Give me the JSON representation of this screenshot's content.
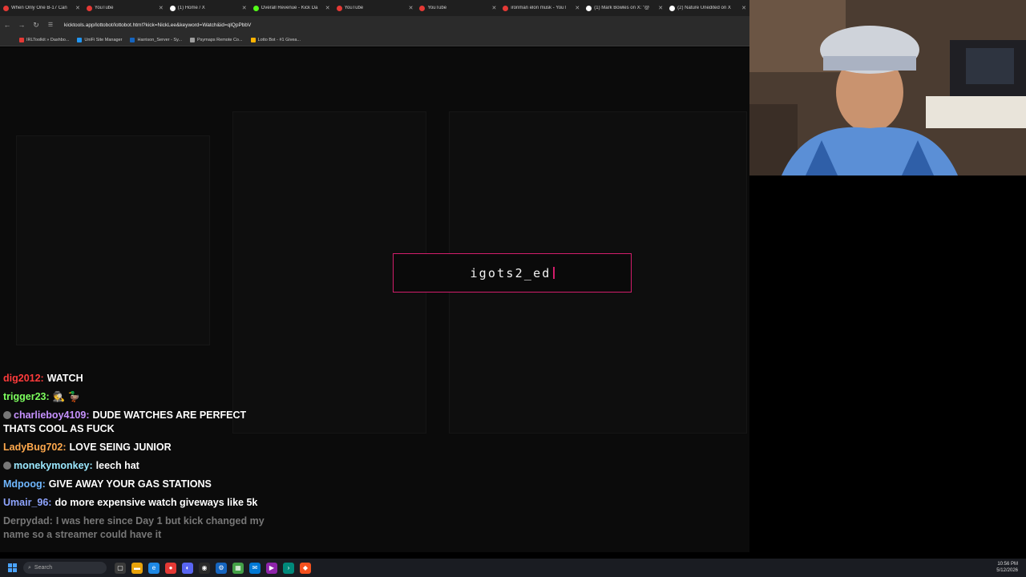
{
  "browser": {
    "tabs": [
      {
        "title": "When Only One B-17 Can",
        "color": "#e53935"
      },
      {
        "title": "YouTube",
        "color": "#e53935"
      },
      {
        "title": "(1) Home / X",
        "color": "#ffffff"
      },
      {
        "title": "Overall Revenue - Kick Da",
        "color": "#53fc18"
      },
      {
        "title": "YouTube",
        "color": "#e53935"
      },
      {
        "title": "YouTube",
        "color": "#e53935"
      },
      {
        "title": "ironman elon musk - YouT",
        "color": "#e53935"
      },
      {
        "title": "(1) Mark Bowles on X: \"@",
        "color": "#ffffff"
      },
      {
        "title": "(2) Nature Unedited on X",
        "color": "#ffffff"
      }
    ],
    "url": "kicktools.app/lottobot/lottobot.html?kick=NickLee&keyword=Watch&id=qlQpPbbV",
    "bookmarks": [
      "IRLToolkit » Dashbo...",
      "UniFi Site Manager",
      "Harrison_Server - Sy...",
      "Psymaps Remote Co...",
      "Lotto Bot - #1 Givea..."
    ],
    "bookmark_colors": [
      "#e53935",
      "#2196f3",
      "#1565c0",
      "#9e9e9e",
      "#ffb300"
    ]
  },
  "lotto": {
    "winner": "igots2_ed",
    "accent": "#d21d6b"
  },
  "chat": [
    {
      "user": "dig2012:",
      "color": "#ff3b3b",
      "text": "WATCH",
      "badge": false
    },
    {
      "user": "trigger23:",
      "color": "#7dff5e",
      "text": "🕵️ 🦆",
      "badge": false
    },
    {
      "user": "charlieboy4109:",
      "color": "#c792ff",
      "text": "DUDE WATCHES ARE PERFECT THATS COOL AS FUCK",
      "badge": true
    },
    {
      "user": "LadyBug702:",
      "color": "#ffa94d",
      "text": "LOVE SEING JUNIOR",
      "badge": false
    },
    {
      "user": "monekymonkey:",
      "color": "#9be8ff",
      "text": "leech hat",
      "badge": true
    },
    {
      "user": "Mdpoog:",
      "color": "#6fb7ff",
      "text": "GIVE AWAY YOUR GAS STATIONS",
      "badge": false
    },
    {
      "user": "Umair_96:",
      "color": "#8fa5ff",
      "text": "do more expensive watch giveways like 5k",
      "badge": false
    },
    {
      "user": "Derpydad:",
      "color": "#777777",
      "text": "I was here since Day 1 but kick changed my name so a streamer could have it",
      "badge": false
    }
  ],
  "taskbar": {
    "search_placeholder": "Search",
    "time": "10:56 PM",
    "date": "5/12/2026"
  }
}
